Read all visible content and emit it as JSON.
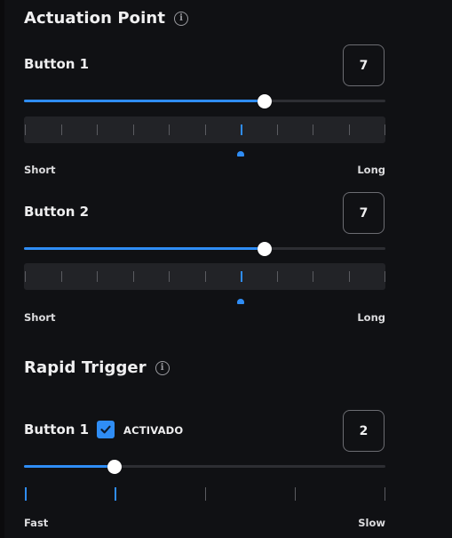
{
  "actuation": {
    "title": "Actuation Point",
    "rows": [
      {
        "label": "Button 1",
        "value": "7",
        "level": 0.667,
        "min_label": "Short",
        "max_label": "Long",
        "ticks": 10,
        "active_tick": 6
      },
      {
        "label": "Button 2",
        "value": "7",
        "level": 0.667,
        "min_label": "Short",
        "max_label": "Long",
        "ticks": 10,
        "active_tick": 6
      }
    ]
  },
  "rapid_trigger": {
    "title": "Rapid Trigger",
    "row": {
      "label": "Button 1",
      "checkbox_label": "ACTIVADO",
      "checked": true,
      "value": "2",
      "level": 0.25,
      "min_label": "Fast",
      "max_label": "Slow",
      "ticks": 5,
      "active_ticks": [
        0,
        1
      ]
    }
  },
  "colors": {
    "accent": "#2f8df5",
    "background": "#101114",
    "track": "#2d2e33",
    "scale_bg": "#222327"
  },
  "icons": {
    "info": "info-icon",
    "check": "check-icon"
  }
}
